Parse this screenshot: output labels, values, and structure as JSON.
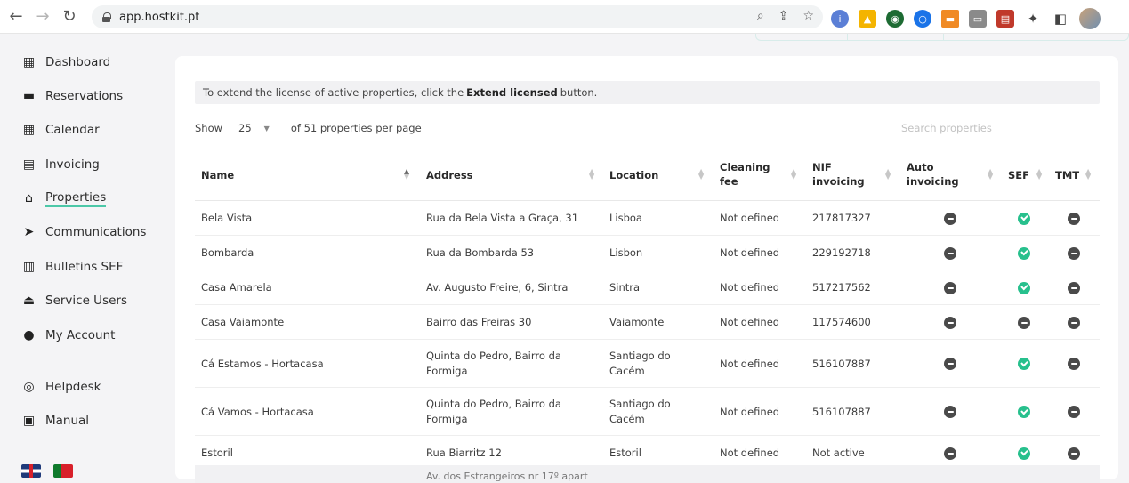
{
  "browser": {
    "url": "app.hostkit.pt"
  },
  "sidebar": {
    "items": [
      {
        "label": "Dashboard",
        "icon": "dashboard-icon",
        "glyph": "▦"
      },
      {
        "label": "Reservations",
        "icon": "bed-icon",
        "glyph": "🛏"
      },
      {
        "label": "Calendar",
        "icon": "calendar-icon",
        "glyph": "▦"
      },
      {
        "label": "Invoicing",
        "icon": "invoice-icon",
        "glyph": "▤"
      },
      {
        "label": "Properties",
        "icon": "home-icon",
        "glyph": "⌂"
      },
      {
        "label": "Communications",
        "icon": "send-icon",
        "glyph": "➤"
      },
      {
        "label": "Bulletins SEF",
        "icon": "bulletin-icon",
        "glyph": "▥"
      },
      {
        "label": "Service Users",
        "icon": "eject-icon",
        "glyph": "⏏"
      },
      {
        "label": "My Account",
        "icon": "user-icon",
        "glyph": "●"
      },
      {
        "label": "Helpdesk",
        "icon": "lifebuoy-icon",
        "glyph": "◎"
      },
      {
        "label": "Manual",
        "icon": "manual-icon",
        "glyph": "▣"
      }
    ],
    "active": "Properties"
  },
  "notice": {
    "before": "To extend the license of active properties, click the",
    "bold": "Extend licensed",
    "after": "button."
  },
  "pagination": {
    "show_label": "Show",
    "page_size": "25",
    "per_page_text": "of 51 properties per page"
  },
  "search": {
    "placeholder": "Search properties"
  },
  "table": {
    "columns": {
      "name": "Name",
      "address": "Address",
      "location": "Location",
      "cleaning_1": "Cleaning",
      "cleaning_2": "fee",
      "nif_1": "NIF",
      "nif_2": "invoicing",
      "auto_1": "Auto",
      "auto_2": "invoicing",
      "sef": "SEF",
      "tmt": "TMT"
    },
    "rows": [
      {
        "name": "Bela Vista",
        "address": [
          "Rua da Bela Vista a Graça, 31"
        ],
        "location": [
          "Lisboa"
        ],
        "cleaning": "Not defined",
        "nif": "217817327",
        "auto": false,
        "sef": true,
        "tmt": false
      },
      {
        "name": "Bombarda",
        "address": [
          "Rua da Bombarda 53"
        ],
        "location": [
          "Lisbon"
        ],
        "cleaning": "Not defined",
        "nif": "229192718",
        "auto": false,
        "sef": true,
        "tmt": false
      },
      {
        "name": "Casa Amarela",
        "address": [
          "Av. Augusto Freire, 6, Sintra"
        ],
        "location": [
          "Sintra"
        ],
        "cleaning": "Not defined",
        "nif": "517217562",
        "auto": false,
        "sef": true,
        "tmt": false
      },
      {
        "name": "Casa Vaiamonte",
        "address": [
          "Bairro das Freiras 30"
        ],
        "location": [
          "Vaiamonte"
        ],
        "cleaning": "Not defined",
        "nif": "117574600",
        "auto": false,
        "sef": false,
        "tmt": false
      },
      {
        "name": "Cá Estamos - Hortacasa",
        "address": [
          "Quinta do Pedro, Bairro da",
          "Formiga"
        ],
        "location": [
          "Santiago do",
          "Cacém"
        ],
        "cleaning": "Not defined",
        "nif": "516107887",
        "auto": false,
        "sef": true,
        "tmt": false
      },
      {
        "name": "Cá Vamos - Hortacasa",
        "address": [
          "Quinta do Pedro, Bairro da",
          "Formiga"
        ],
        "location": [
          "Santiago do",
          "Cacém"
        ],
        "cleaning": "Not defined",
        "nif": "516107887",
        "auto": false,
        "sef": true,
        "tmt": false
      },
      {
        "name": "Estoril",
        "address": [
          "Rua Biarritz 12"
        ],
        "location": [
          "Estoril"
        ],
        "cleaning": "Not defined",
        "nif": "Not active",
        "auto": false,
        "sef": true,
        "tmt": false
      }
    ],
    "partial_next": "Av. dos Estrangeiros nr 17º apart"
  }
}
